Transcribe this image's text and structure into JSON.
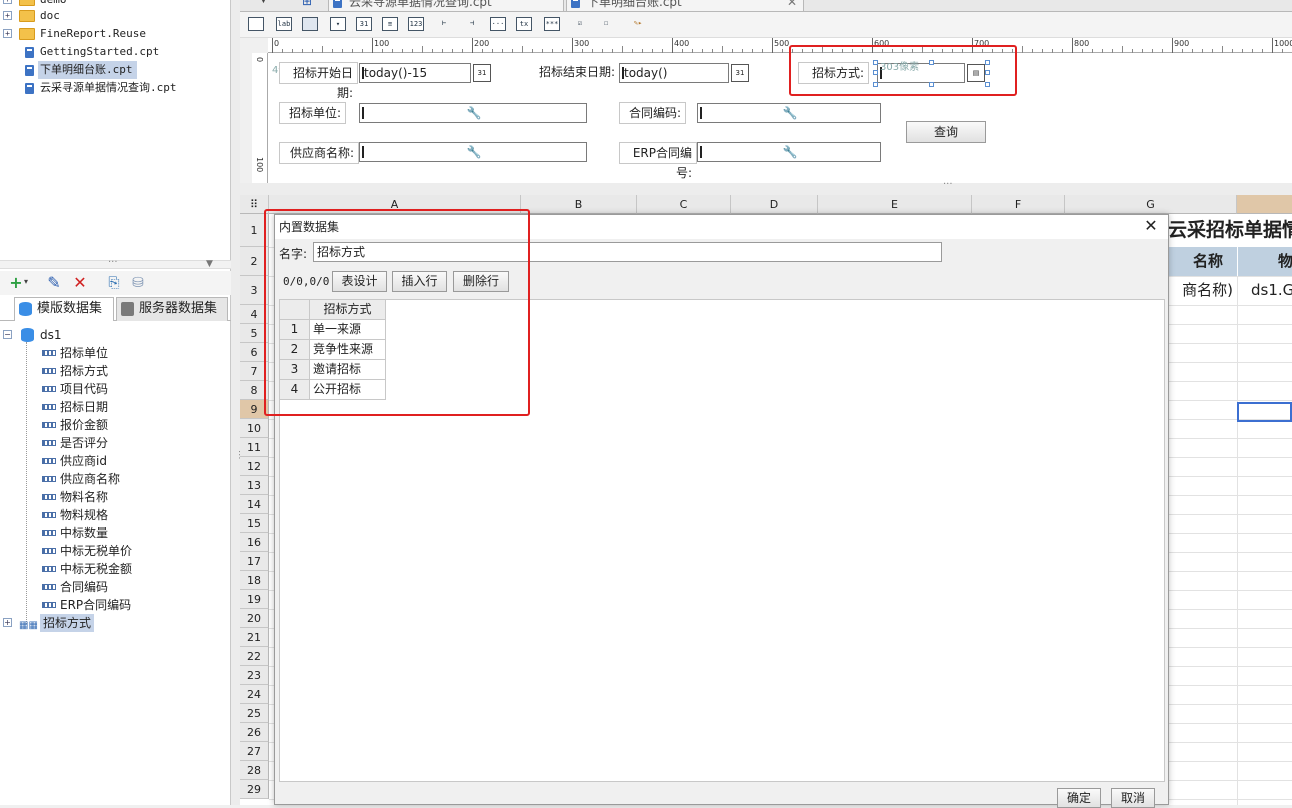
{
  "file_tree": {
    "items": [
      {
        "label": "demo",
        "type": "folder"
      },
      {
        "label": "doc",
        "type": "folder"
      },
      {
        "label": "FineReport.Reuse",
        "type": "folder"
      },
      {
        "label": "GettingStarted.cpt",
        "type": "cpt"
      },
      {
        "label": "下单明细台账.cpt",
        "type": "cpt",
        "selected": true
      },
      {
        "label": "云采寻源单据情况查询.cpt",
        "type": "cpt"
      }
    ]
  },
  "dataset_panel": {
    "tab_template": "模版数据集",
    "tab_server": "服务器数据集",
    "ds_name": "ds1",
    "fields": [
      "招标单位",
      "招标方式",
      "项目代码",
      "招标日期",
      "报价金额",
      "是否评分",
      "供应商id",
      "供应商名称",
      "物料名称",
      "物料规格",
      "中标数量",
      "中标无税单价",
      "中标无税金额",
      "合同编码",
      "ERP合同编码"
    ],
    "extra_ds": "招标方式"
  },
  "editor_tabs": [
    {
      "label": "云采寻源单据情况查询.cpt"
    },
    {
      "label": "下单明细台账.cpt"
    }
  ],
  "widget_icons": [
    "text-field-icon",
    "label-icon",
    "button-icon",
    "combo-icon",
    "date-icon",
    "number-icon",
    "tree-icon",
    "textarea-icon",
    "password-icon",
    "checkbox-icon",
    "radio-icon",
    "chart-icon"
  ],
  "widget_texts": [
    "lab",
    "31",
    "123",
    "tx"
  ],
  "ruler": {
    "h_ticks": [
      "0",
      "100",
      "200",
      "300",
      "400",
      "500",
      "600",
      "700",
      "800",
      "900",
      "1000"
    ],
    "v_ticks": [
      "0",
      "100"
    ],
    "size_hint": "4像素",
    "size_hint_2": "303像素"
  },
  "form": {
    "start_date_label": "招标开始日期:",
    "start_date_value": "today()-15",
    "end_date_label": "招标结束日期:",
    "end_date_value": "today()",
    "method_label": "招标方式:",
    "unit_label": "招标单位:",
    "contract_label": "合同编码:",
    "supplier_label": "供应商名称:",
    "erp_label": "ERP合同编号:",
    "query_button": "查询",
    "cal_text": "31"
  },
  "sheet": {
    "columns": [
      "A",
      "B",
      "C",
      "D",
      "E",
      "F",
      "G"
    ],
    "rows": [
      "1",
      "2",
      "3",
      "4",
      "5",
      "6",
      "7",
      "8",
      "9",
      "10",
      "11",
      "12",
      "13",
      "14",
      "15",
      "16",
      "17",
      "18",
      "19",
      "20",
      "21",
      "22",
      "23",
      "24",
      "25",
      "26",
      "27",
      "28",
      "29"
    ],
    "title_partial": "云采招标单据情",
    "h2_partial": "名称",
    "h2_partial_2": "物",
    "r3_partial": "商名称)",
    "r3_partial_2": "ds1.G"
  },
  "dialog": {
    "title": "内置数据集",
    "name_label": "名字:",
    "name_value": "招标方式",
    "position": "0/0,0/0",
    "btn_design": "表设计",
    "btn_insert": "插入行",
    "btn_delete": "删除行",
    "table_header": "招标方式",
    "rows": [
      {
        "idx": "1",
        "value": "单一来源"
      },
      {
        "idx": "2",
        "value": "竞争性来源"
      },
      {
        "idx": "3",
        "value": "邀请招标"
      },
      {
        "idx": "4",
        "value": "公开招标"
      }
    ],
    "ok": "确定",
    "cancel": "取消",
    "close": "✕"
  },
  "colors": {
    "highlight_red": "#e02020",
    "selection_blue": "#c5d3e8",
    "header_band": "#bfd0e0"
  }
}
